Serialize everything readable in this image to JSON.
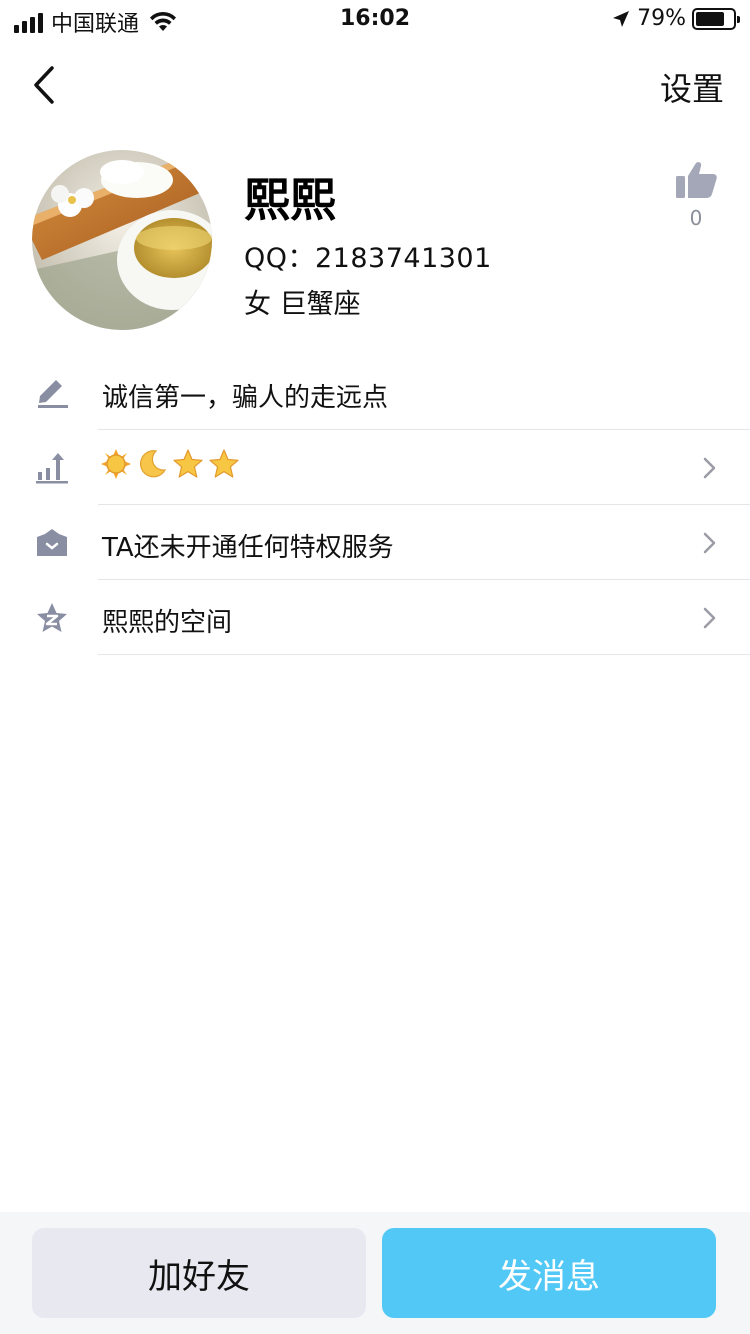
{
  "status_bar": {
    "carrier": "中国联通",
    "time": "16:02",
    "battery_percent": "79%",
    "battery_level": 0.79
  },
  "nav": {
    "back_icon": "chevron-left-icon",
    "settings_label": "设置"
  },
  "profile": {
    "name": "熙熙",
    "qq": "QQ：2183741301",
    "gender_zodiac": "女  巨蟹座",
    "like_count": "0",
    "like_icon": "thumbs-up-icon"
  },
  "list": {
    "signature": "诚信第一，骗人的走远点",
    "level_icons": [
      "sun-icon",
      "moon-icon",
      "star-icon",
      "star-icon"
    ],
    "privilege": "TA还未开通任何特权服务",
    "space": "熙熙的空间"
  },
  "actions": {
    "add_friend": "加好友",
    "send_message": "发消息"
  },
  "colors": {
    "accent": "#51c8f5",
    "secondary_button": "#e8e9f0",
    "icon_gray": "#8a8ea3"
  }
}
